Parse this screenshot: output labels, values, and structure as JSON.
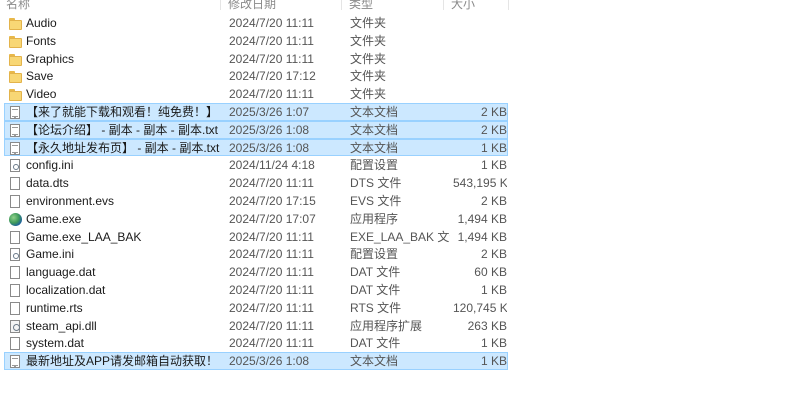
{
  "columns": {
    "name": "名称",
    "date": "修改日期",
    "type": "类型",
    "size": "大小"
  },
  "files": [
    {
      "name": "Audio",
      "date": "2024/7/20 11:11",
      "type": "文件夹",
      "size": "",
      "icon": "folder-icon",
      "selected": false
    },
    {
      "name": "Fonts",
      "date": "2024/7/20 11:11",
      "type": "文件夹",
      "size": "",
      "icon": "folder-icon",
      "selected": false
    },
    {
      "name": "Graphics",
      "date": "2024/7/20 11:11",
      "type": "文件夹",
      "size": "",
      "icon": "folder-icon",
      "selected": false
    },
    {
      "name": "Save",
      "date": "2024/7/20 17:12",
      "type": "文件夹",
      "size": "",
      "icon": "folder-icon",
      "selected": false
    },
    {
      "name": "Video",
      "date": "2024/7/20 11:11",
      "type": "文件夹",
      "size": "",
      "icon": "folder-icon",
      "selected": false
    },
    {
      "name": "【来了就能下载和观看！纯免费！】 - 副...",
      "date": "2025/3/26 1:07",
      "type": "文本文档",
      "size": "2 KB",
      "icon": "text-document-icon",
      "selected": true
    },
    {
      "name": "【论坛介绍】 - 副本 - 副本 - 副本.txt",
      "date": "2025/3/26 1:08",
      "type": "文本文档",
      "size": "2 KB",
      "icon": "text-document-icon",
      "selected": true
    },
    {
      "name": "【永久地址发布页】 - 副本 - 副本.txt",
      "date": "2025/3/26 1:08",
      "type": "文本文档",
      "size": "1 KB",
      "icon": "text-document-icon",
      "selected": true
    },
    {
      "name": "config.ini",
      "date": "2024/11/24 4:18",
      "type": "配置设置",
      "size": "1 KB",
      "icon": "settings-file-icon",
      "selected": false
    },
    {
      "name": "data.dts",
      "date": "2024/7/20 11:11",
      "type": "DTS 文件",
      "size": "543,195 KB",
      "icon": "file-icon",
      "selected": false
    },
    {
      "name": "environment.evs",
      "date": "2024/7/20 17:15",
      "type": "EVS 文件",
      "size": "2 KB",
      "icon": "file-icon",
      "selected": false
    },
    {
      "name": "Game.exe",
      "date": "2024/7/20 17:07",
      "type": "应用程序",
      "size": "1,494 KB",
      "icon": "game-exe-icon",
      "selected": false
    },
    {
      "name": "Game.exe_LAA_BAK",
      "date": "2024/7/20 11:11",
      "type": "EXE_LAA_BAK 文件",
      "size": "1,494 KB",
      "icon": "file-icon",
      "selected": false
    },
    {
      "name": "Game.ini",
      "date": "2024/7/20 11:11",
      "type": "配置设置",
      "size": "2 KB",
      "icon": "settings-file-icon",
      "selected": false
    },
    {
      "name": "language.dat",
      "date": "2024/7/20 11:11",
      "type": "DAT 文件",
      "size": "60 KB",
      "icon": "file-icon",
      "selected": false
    },
    {
      "name": "localization.dat",
      "date": "2024/7/20 11:11",
      "type": "DAT 文件",
      "size": "1 KB",
      "icon": "file-icon",
      "selected": false
    },
    {
      "name": "runtime.rts",
      "date": "2024/7/20 11:11",
      "type": "RTS 文件",
      "size": "120,745 KB",
      "icon": "file-icon",
      "selected": false
    },
    {
      "name": "steam_api.dll",
      "date": "2024/7/20 11:11",
      "type": "应用程序扩展",
      "size": "263 KB",
      "icon": "dll-icon",
      "selected": false
    },
    {
      "name": "system.dat",
      "date": "2024/7/20 11:11",
      "type": "DAT 文件",
      "size": "1 KB",
      "icon": "file-icon",
      "selected": false
    },
    {
      "name": "最新地址及APP请发邮箱自动获取！！！...",
      "date": "2025/3/26 1:08",
      "type": "文本文档",
      "size": "1 KB",
      "icon": "text-document-icon",
      "selected": true
    }
  ]
}
